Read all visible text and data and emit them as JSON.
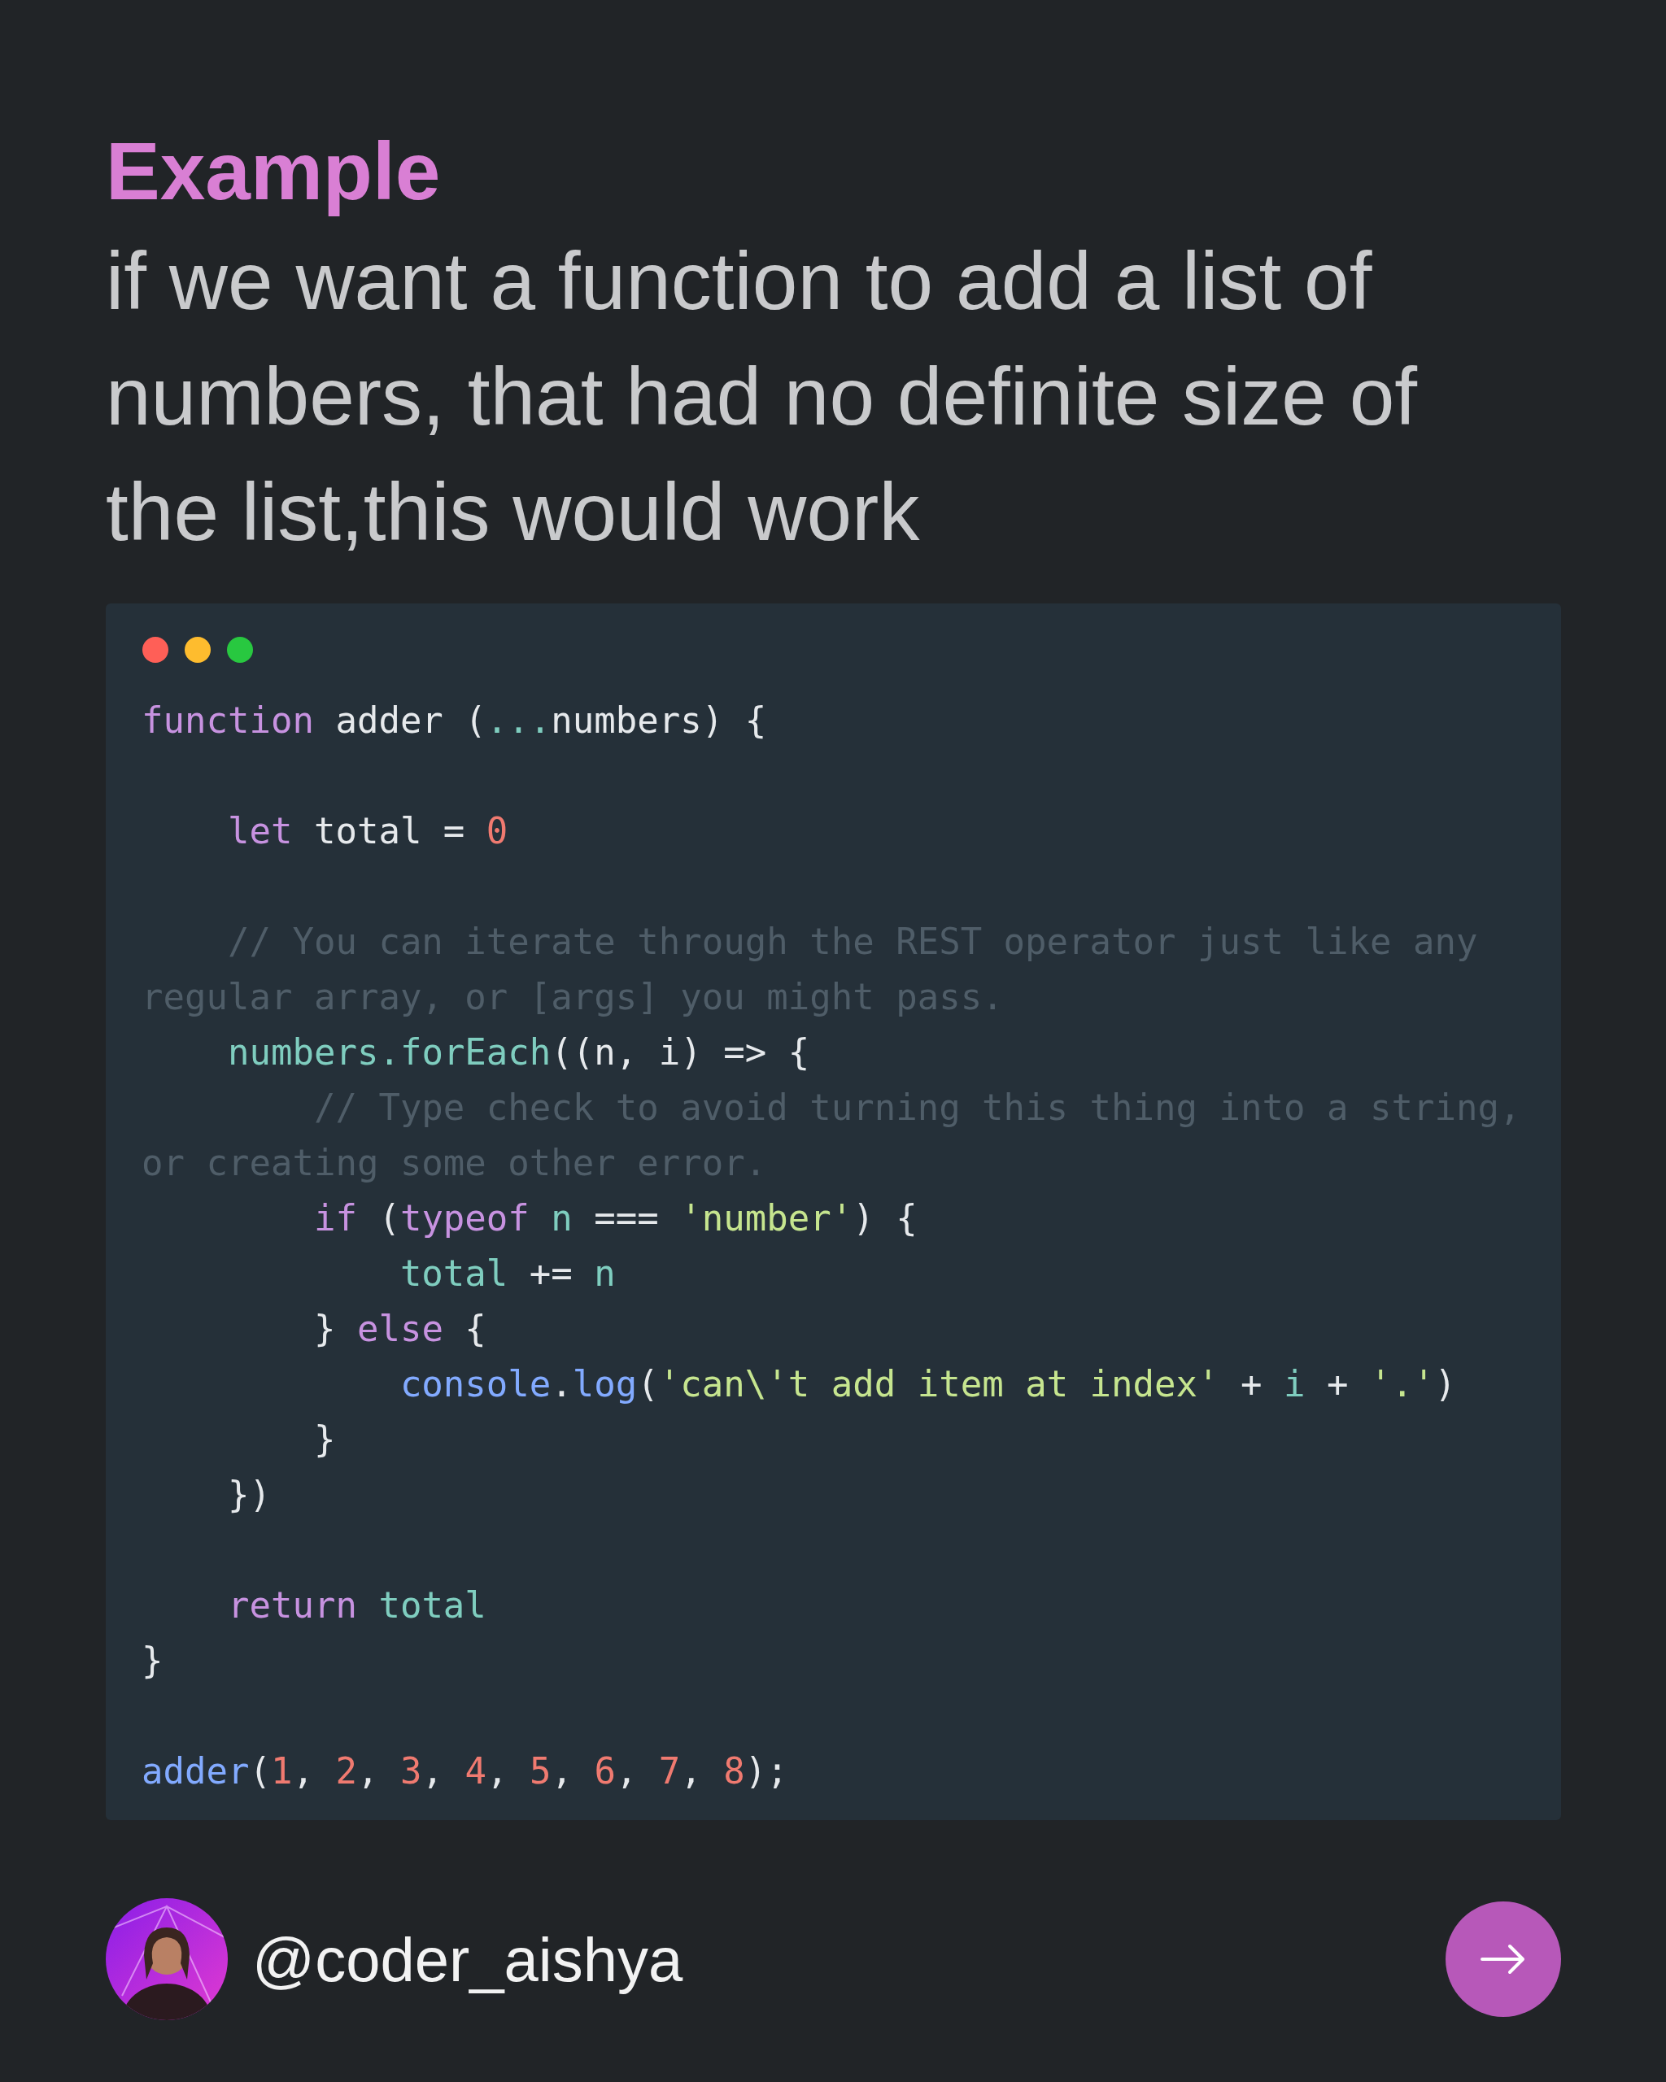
{
  "title": "Example",
  "description": "if we want a function to add a list of numbers, that had no definite size of the list,this would work",
  "code_window": {
    "lines": [
      {
        "kind": "code",
        "tokens": [
          {
            "kind": "keyword",
            "text": "function"
          },
          {
            "kind": "text",
            "text": " adder ("
          },
          {
            "kind": "variable",
            "text": "..."
          },
          {
            "kind": "text",
            "text": "numbers) {"
          }
        ]
      },
      {
        "kind": "blank"
      },
      {
        "kind": "code",
        "tokens": [
          {
            "kind": "keyword",
            "text": "    let"
          },
          {
            "kind": "text",
            "text": " total = "
          },
          {
            "kind": "number",
            "text": "0"
          }
        ]
      },
      {
        "kind": "blank"
      },
      {
        "kind": "code",
        "tokens": [
          {
            "kind": "comment",
            "text": "    // You can iterate through the REST operator just like any"
          }
        ]
      },
      {
        "kind": "code",
        "tokens": [
          {
            "kind": "comment",
            "text": "regular array, or [args] you might pass."
          }
        ]
      },
      {
        "kind": "code",
        "tokens": [
          {
            "kind": "variable",
            "text": "    numbers"
          },
          {
            "kind": "variable",
            "text": ".forEach"
          },
          {
            "kind": "text",
            "text": "((n, i) => {"
          }
        ]
      },
      {
        "kind": "code",
        "tokens": [
          {
            "kind": "comment",
            "text": "        // Type check to avoid turning this thing into a string,"
          }
        ]
      },
      {
        "kind": "code",
        "tokens": [
          {
            "kind": "comment",
            "text": "or creating some other error."
          }
        ]
      },
      {
        "kind": "code",
        "tokens": [
          {
            "kind": "keyword",
            "text": "        if"
          },
          {
            "kind": "text",
            "text": " ("
          },
          {
            "kind": "keyword",
            "text": "typeof"
          },
          {
            "kind": "variable",
            "text": " n"
          },
          {
            "kind": "text",
            "text": " === "
          },
          {
            "kind": "string",
            "text": "'number'"
          },
          {
            "kind": "text",
            "text": ") {"
          }
        ]
      },
      {
        "kind": "code",
        "tokens": [
          {
            "kind": "variable",
            "text": "            total"
          },
          {
            "kind": "text",
            "text": " += "
          },
          {
            "kind": "variable",
            "text": "n"
          }
        ]
      },
      {
        "kind": "code",
        "tokens": [
          {
            "kind": "text",
            "text": "        } "
          },
          {
            "kind": "keyword",
            "text": "else"
          },
          {
            "kind": "text",
            "text": " {"
          }
        ]
      },
      {
        "kind": "code",
        "tokens": [
          {
            "kind": "call",
            "text": "            console"
          },
          {
            "kind": "text",
            "text": "."
          },
          {
            "kind": "call",
            "text": "log"
          },
          {
            "kind": "text",
            "text": "("
          },
          {
            "kind": "string",
            "text": "'can\\'t add item at index'"
          },
          {
            "kind": "text",
            "text": " + "
          },
          {
            "kind": "variable",
            "text": "i"
          },
          {
            "kind": "text",
            "text": " + "
          },
          {
            "kind": "string",
            "text": "'.'"
          },
          {
            "kind": "text",
            "text": ")"
          }
        ]
      },
      {
        "kind": "code",
        "tokens": [
          {
            "kind": "text",
            "text": "        }"
          }
        ]
      },
      {
        "kind": "code",
        "tokens": [
          {
            "kind": "text",
            "text": "    })"
          }
        ]
      },
      {
        "kind": "blank"
      },
      {
        "kind": "code",
        "tokens": [
          {
            "kind": "keyword",
            "text": "    return"
          },
          {
            "kind": "variable",
            "text": " total"
          }
        ]
      },
      {
        "kind": "code",
        "tokens": [
          {
            "kind": "text",
            "text": "}"
          }
        ]
      },
      {
        "kind": "blank"
      },
      {
        "kind": "code",
        "tokens": [
          {
            "kind": "call",
            "text": "adder"
          },
          {
            "kind": "text",
            "text": "("
          },
          {
            "kind": "number",
            "text": "1"
          },
          {
            "kind": "text",
            "text": ", "
          },
          {
            "kind": "number",
            "text": "2"
          },
          {
            "kind": "text",
            "text": ", "
          },
          {
            "kind": "number",
            "text": "3"
          },
          {
            "kind": "text",
            "text": ", "
          },
          {
            "kind": "number",
            "text": "4"
          },
          {
            "kind": "text",
            "text": ", "
          },
          {
            "kind": "number",
            "text": "5"
          },
          {
            "kind": "text",
            "text": ", "
          },
          {
            "kind": "number",
            "text": "6"
          },
          {
            "kind": "text",
            "text": ", "
          },
          {
            "kind": "number",
            "text": "7"
          },
          {
            "kind": "text",
            "text": ", "
          },
          {
            "kind": "number",
            "text": "8"
          },
          {
            "kind": "text",
            "text": ");"
          }
        ]
      }
    ]
  },
  "footer": {
    "handle": "@coder_aishya"
  }
}
